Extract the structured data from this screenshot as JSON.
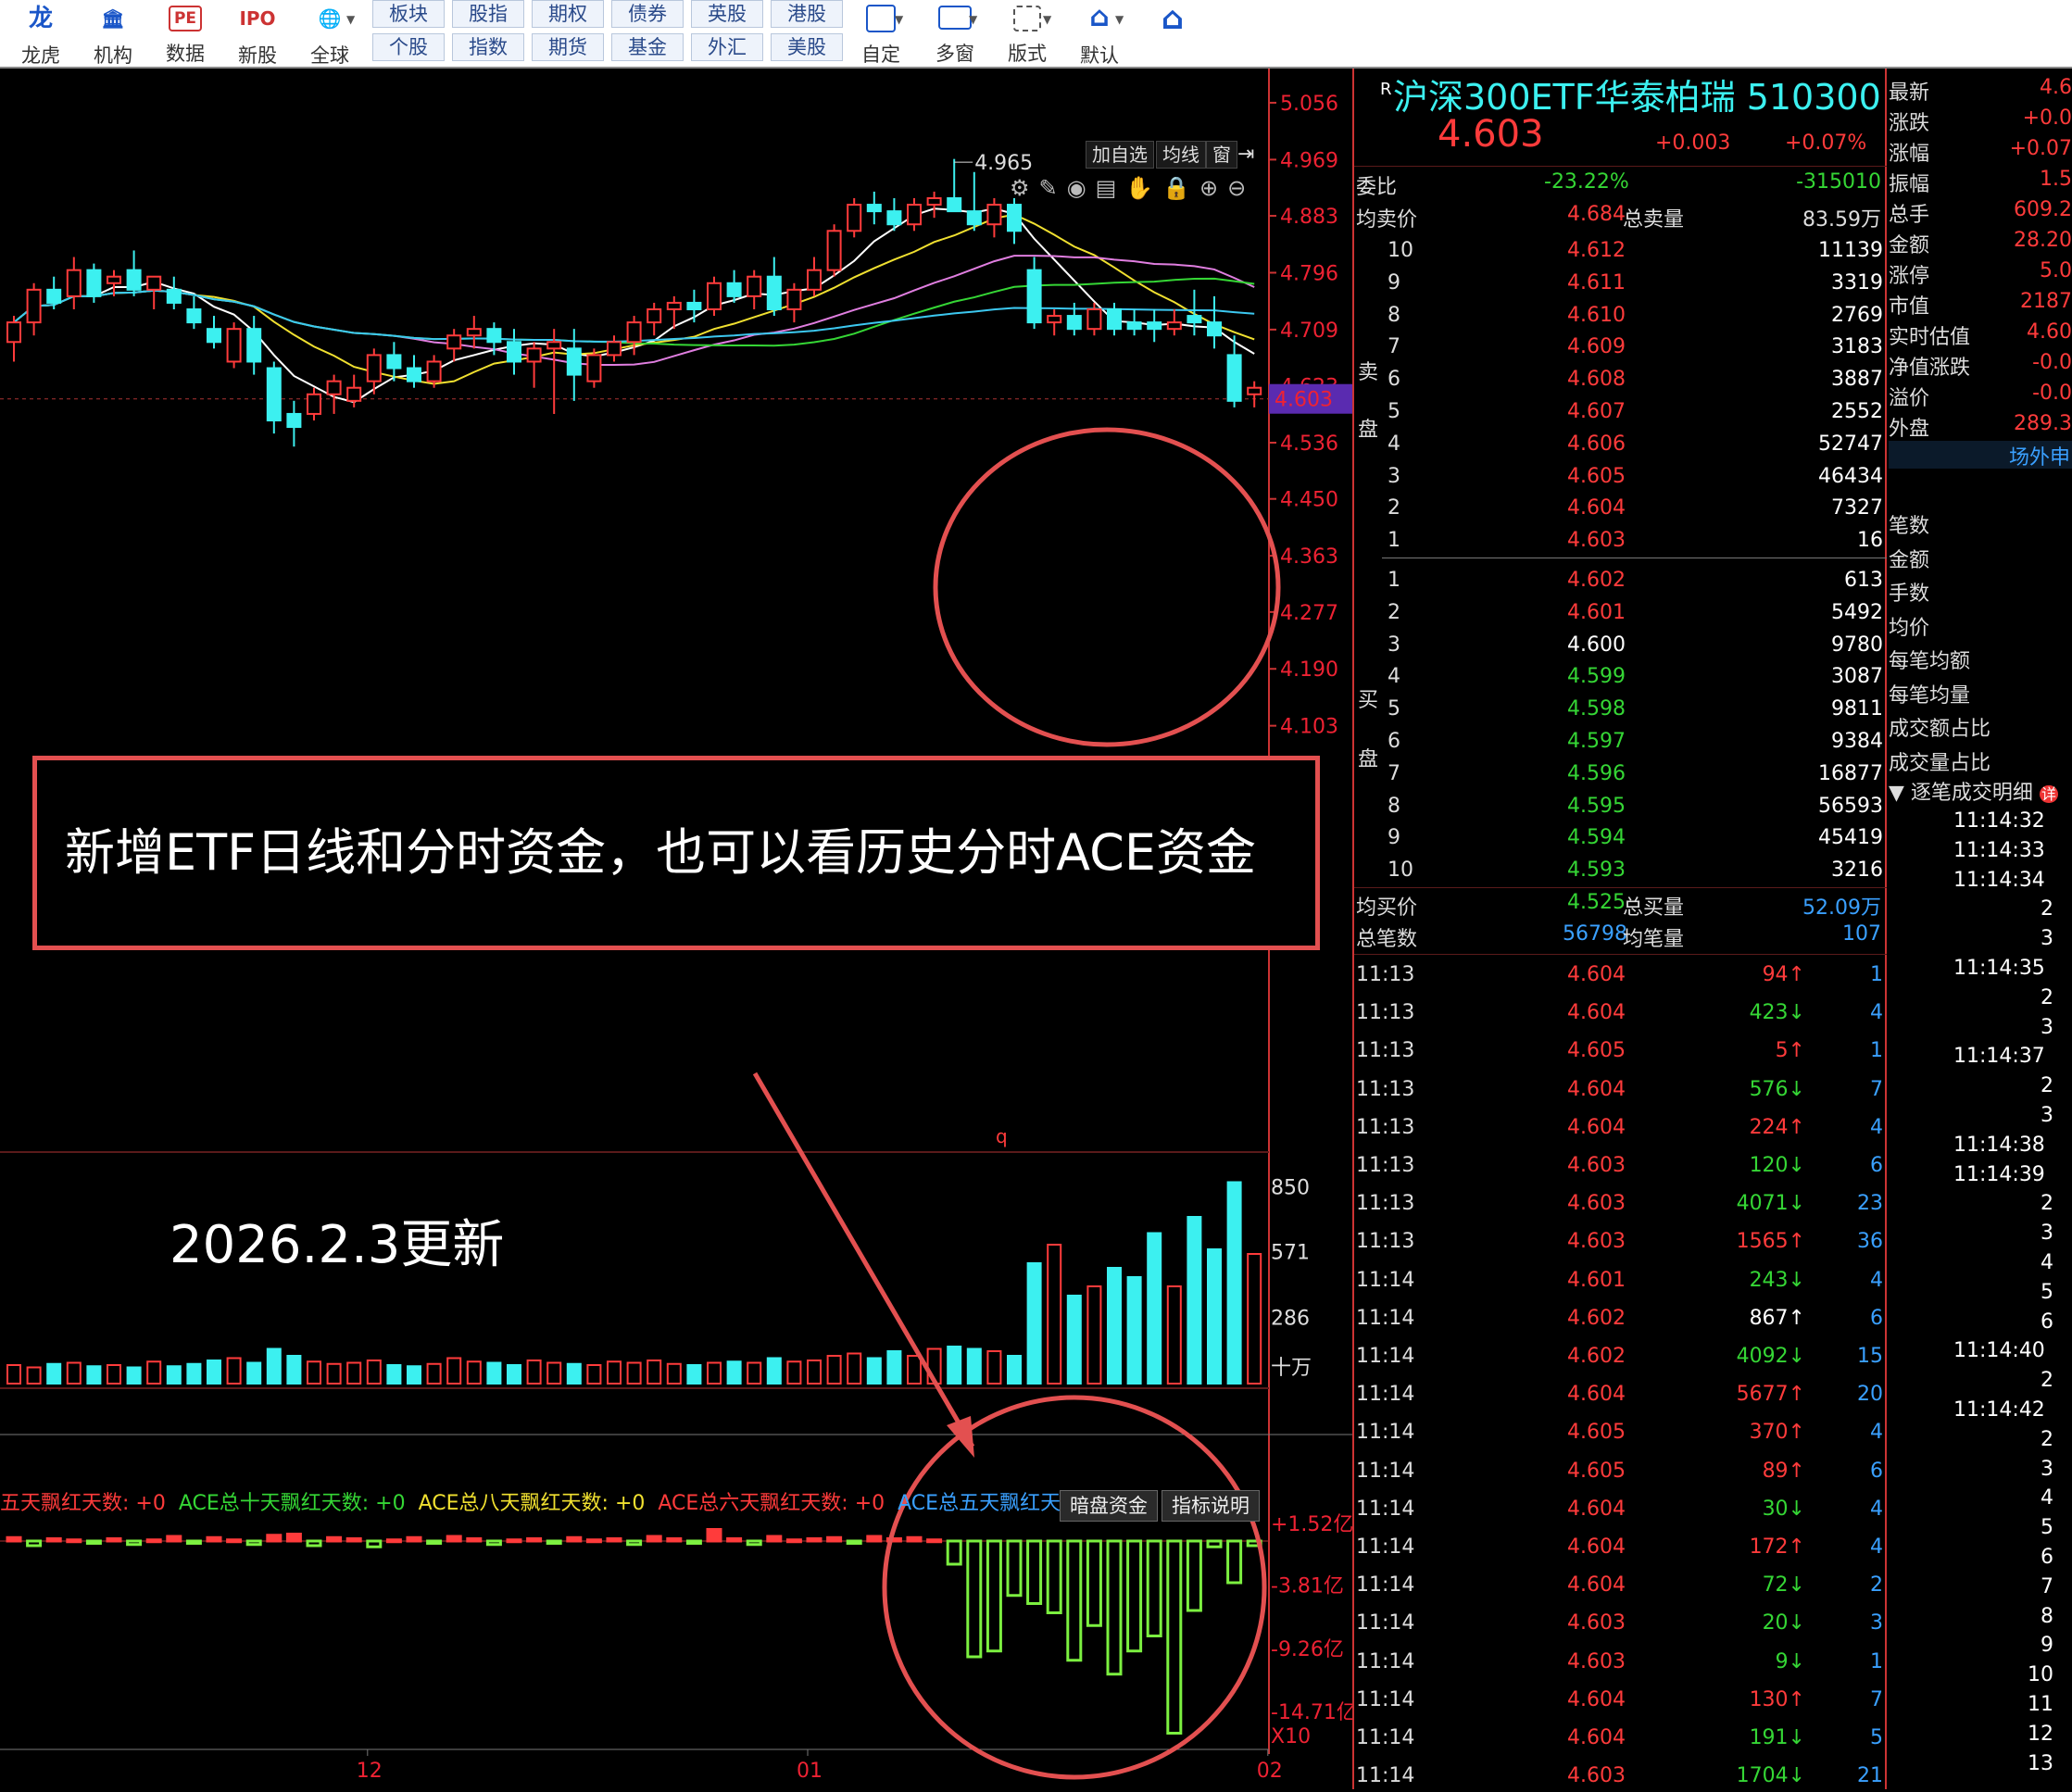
{
  "toolbar": {
    "buttons": [
      {
        "label": "龙虎",
        "icon": "龙"
      },
      {
        "label": "机构",
        "icon": "🏛"
      },
      {
        "label": "数据",
        "icon": "PE"
      },
      {
        "label": "新股",
        "icon": "IPO"
      },
      {
        "label": "全球",
        "icon": "🌐"
      }
    ],
    "markets_top": [
      "板块",
      "股指",
      "期权",
      "债券",
      "英股",
      "港股"
    ],
    "markets_bottom": [
      "个股",
      "指数",
      "期货",
      "基金",
      "外汇",
      "美股"
    ],
    "tools": [
      {
        "label": "自定"
      },
      {
        "label": "多窗"
      },
      {
        "label": "版式"
      },
      {
        "label": "默认"
      }
    ]
  },
  "chart": {
    "tabs": [
      "加自选",
      "均线",
      "窗"
    ],
    "price_axis": [
      "5.056",
      "4.969",
      "4.883",
      "4.796",
      "4.709",
      "4.623",
      "4.536",
      "4.450",
      "4.363",
      "4.277",
      "4.190",
      "4.103"
    ],
    "current_price": "4.603",
    "high_label": "4.965",
    "banner_text": "新增ETF日线和分时资金，也可以看历史分时ACE资金",
    "update_text": "2026.2.3更新",
    "vol_marker": "q",
    "volume_axis": [
      "850",
      "571",
      "286"
    ],
    "volume_unit": "十万",
    "ace_legend": [
      {
        "text": "五天飘红天数: +0",
        "color": "#ff3b3b"
      },
      {
        "text": "ACE总十天飘红天数: +0",
        "color": "#35d635"
      },
      {
        "text": "ACE总八天飘红天数: +0",
        "color": "#f0e030"
      },
      {
        "text": "ACE总六天飘红天数: +0",
        "color": "#ff3b3b"
      },
      {
        "text": "ACE总五天飘红天数: +0",
        "color": "#3aa0ff"
      }
    ],
    "ace_buttons": [
      "暗盘资金",
      "指标说明"
    ],
    "ace_axis": [
      "+1.52亿",
      "-3.81亿",
      "-9.26亿",
      "-14.71亿"
    ],
    "ace_unit": "X10",
    "date_axis": [
      "12",
      "01",
      "02"
    ]
  },
  "chart_data": {
    "type": "candlestick",
    "ylim": [
      4.06,
      5.08
    ],
    "candles": [
      [
        4.69,
        4.73,
        4.66,
        4.72
      ],
      [
        4.72,
        4.78,
        4.7,
        4.77
      ],
      [
        4.77,
        4.79,
        4.74,
        4.75
      ],
      [
        4.76,
        4.82,
        4.74,
        4.8
      ],
      [
        4.8,
        4.81,
        4.75,
        4.76
      ],
      [
        4.78,
        4.8,
        4.76,
        4.79
      ],
      [
        4.8,
        4.83,
        4.76,
        4.77
      ],
      [
        4.77,
        4.79,
        4.74,
        4.79
      ],
      [
        4.77,
        4.79,
        4.74,
        4.75
      ],
      [
        4.74,
        4.76,
        4.71,
        4.72
      ],
      [
        4.71,
        4.73,
        4.68,
        4.69
      ],
      [
        4.66,
        4.72,
        4.65,
        4.71
      ],
      [
        4.71,
        4.73,
        4.64,
        4.66
      ],
      [
        4.65,
        4.66,
        4.55,
        4.57
      ],
      [
        4.58,
        4.6,
        4.53,
        4.56
      ],
      [
        4.58,
        4.62,
        4.57,
        4.61
      ],
      [
        4.61,
        4.64,
        4.58,
        4.63
      ],
      [
        4.6,
        4.64,
        4.59,
        4.62
      ],
      [
        4.63,
        4.68,
        4.61,
        4.67
      ],
      [
        4.67,
        4.69,
        4.63,
        4.65
      ],
      [
        4.65,
        4.67,
        4.62,
        4.63
      ],
      [
        4.63,
        4.67,
        4.62,
        4.66
      ],
      [
        4.68,
        4.71,
        4.66,
        4.7
      ],
      [
        4.7,
        4.73,
        4.68,
        4.71
      ],
      [
        4.71,
        4.72,
        4.67,
        4.69
      ],
      [
        4.69,
        4.71,
        4.64,
        4.66
      ],
      [
        4.66,
        4.69,
        4.62,
        4.68
      ],
      [
        4.68,
        4.71,
        4.58,
        4.69
      ],
      [
        4.68,
        4.71,
        4.6,
        4.64
      ],
      [
        4.63,
        4.68,
        4.62,
        4.67
      ],
      [
        4.67,
        4.7,
        4.66,
        4.69
      ],
      [
        4.69,
        4.73,
        4.67,
        4.72
      ],
      [
        4.72,
        4.75,
        4.7,
        4.74
      ],
      [
        4.74,
        4.76,
        4.71,
        4.75
      ],
      [
        4.75,
        4.77,
        4.72,
        4.74
      ],
      [
        4.74,
        4.79,
        4.73,
        4.78
      ],
      [
        4.78,
        4.8,
        4.75,
        4.76
      ],
      [
        4.76,
        4.8,
        4.74,
        4.79
      ],
      [
        4.79,
        4.82,
        4.73,
        4.74
      ],
      [
        4.74,
        4.78,
        4.72,
        4.77
      ],
      [
        4.77,
        4.82,
        4.76,
        4.8
      ],
      [
        4.8,
        4.87,
        4.79,
        4.86
      ],
      [
        4.86,
        4.91,
        4.85,
        4.9
      ],
      [
        4.9,
        4.92,
        4.87,
        4.89
      ],
      [
        4.89,
        4.91,
        4.86,
        4.87
      ],
      [
        4.87,
        4.91,
        4.86,
        4.9
      ],
      [
        4.9,
        4.92,
        4.88,
        4.91
      ],
      [
        4.91,
        4.97,
        4.89,
        4.89
      ],
      [
        4.89,
        4.95,
        4.86,
        4.87
      ],
      [
        4.87,
        4.91,
        4.85,
        4.9
      ],
      [
        4.9,
        4.91,
        4.84,
        4.86
      ],
      [
        4.8,
        4.82,
        4.71,
        4.72
      ],
      [
        4.72,
        4.74,
        4.7,
        4.73
      ],
      [
        4.73,
        4.75,
        4.7,
        4.71
      ],
      [
        4.71,
        4.75,
        4.7,
        4.74
      ],
      [
        4.74,
        4.75,
        4.7,
        4.71
      ],
      [
        4.72,
        4.74,
        4.7,
        4.71
      ],
      [
        4.72,
        4.74,
        4.69,
        4.71
      ],
      [
        4.71,
        4.74,
        4.7,
        4.72
      ],
      [
        4.73,
        4.77,
        4.7,
        4.72
      ],
      [
        4.72,
        4.76,
        4.68,
        4.7
      ],
      [
        4.67,
        4.7,
        4.59,
        4.6
      ],
      [
        4.61,
        4.63,
        4.59,
        4.62
      ]
    ],
    "volume_ticks": [
      850,
      571,
      286
    ],
    "ace_ticks": [
      "+1.52亿",
      "-3.81亿",
      "-9.26亿",
      "-14.71亿"
    ]
  },
  "quote": {
    "badge": "R",
    "title": "沪深300ETF华泰柏瑞 510300",
    "price": "4.603",
    "change": "+0.003",
    "change_pct": "+0.07%",
    "weibi_label": "委比",
    "weibi_pct": "-23.22%",
    "weibi_val": "-315010",
    "avg_sell_label": "均卖价",
    "avg_sell": "4.684",
    "total_sell_label": "总卖量",
    "total_sell": "83.59万",
    "sell_side_label": "卖",
    "sell_side_label2": "盘",
    "buy_side_label": "买",
    "buy_side_label2": "盘",
    "asks": [
      {
        "n": "10",
        "p": "4.612",
        "v": "11139"
      },
      {
        "n": "9",
        "p": "4.611",
        "v": "3319"
      },
      {
        "n": "8",
        "p": "4.610",
        "v": "2769"
      },
      {
        "n": "7",
        "p": "4.609",
        "v": "3183"
      },
      {
        "n": "6",
        "p": "4.608",
        "v": "3887"
      },
      {
        "n": "5",
        "p": "4.607",
        "v": "2552"
      },
      {
        "n": "4",
        "p": "4.606",
        "v": "52747"
      },
      {
        "n": "3",
        "p": "4.605",
        "v": "46434"
      },
      {
        "n": "2",
        "p": "4.604",
        "v": "7327"
      },
      {
        "n": "1",
        "p": "4.603",
        "v": "16"
      }
    ],
    "bids": [
      {
        "n": "1",
        "p": "4.602",
        "v": "613",
        "c": "#ff3b3b"
      },
      {
        "n": "2",
        "p": "4.601",
        "v": "5492",
        "c": "#ff3b3b"
      },
      {
        "n": "3",
        "p": "4.600",
        "v": "9780",
        "c": "#ffffff"
      },
      {
        "n": "4",
        "p": "4.599",
        "v": "3087",
        "c": "#35d635"
      },
      {
        "n": "5",
        "p": "4.598",
        "v": "9811",
        "c": "#35d635"
      },
      {
        "n": "6",
        "p": "4.597",
        "v": "9384",
        "c": "#35d635"
      },
      {
        "n": "7",
        "p": "4.596",
        "v": "16877",
        "c": "#35d635"
      },
      {
        "n": "8",
        "p": "4.595",
        "v": "56593",
        "c": "#35d635"
      },
      {
        "n": "9",
        "p": "4.594",
        "v": "45419",
        "c": "#35d635"
      },
      {
        "n": "10",
        "p": "4.593",
        "v": "3216",
        "c": "#35d635"
      }
    ],
    "avg_buy_label": "均买价",
    "avg_buy": "4.525",
    "total_buy_label": "总买量",
    "total_buy": "52.09万",
    "total_trades_label": "总笔数",
    "total_trades": "56798",
    "avg_per_trade_label": "均笔量",
    "avg_per_trade": "107",
    "ticks": [
      {
        "t": "11:13",
        "p": "4.604",
        "v": "94",
        "d": "↑",
        "n": "1"
      },
      {
        "t": "11:13",
        "p": "4.604",
        "v": "423",
        "d": "↓",
        "n": "4"
      },
      {
        "t": "11:13",
        "p": "4.605",
        "v": "5",
        "d": "↑",
        "n": "1"
      },
      {
        "t": "11:13",
        "p": "4.604",
        "v": "576",
        "d": "↓",
        "n": "7"
      },
      {
        "t": "11:13",
        "p": "4.604",
        "v": "224",
        "d": "↑",
        "n": "4"
      },
      {
        "t": "11:13",
        "p": "4.603",
        "v": "120",
        "d": "↓",
        "n": "6"
      },
      {
        "t": "11:13",
        "p": "4.603",
        "v": "4071",
        "d": "↓",
        "n": "23"
      },
      {
        "t": "11:13",
        "p": "4.603",
        "v": "1565",
        "d": "↑",
        "n": "36"
      },
      {
        "t": "11:14",
        "p": "4.601",
        "v": "243",
        "d": "↓",
        "n": "4"
      },
      {
        "t": "11:14",
        "p": "4.602",
        "v": "867",
        "d": "↑",
        "n": "6"
      },
      {
        "t": "11:14",
        "p": "4.602",
        "v": "4092",
        "d": "↓",
        "n": "15"
      },
      {
        "t": "11:14",
        "p": "4.604",
        "v": "5677",
        "d": "↑",
        "n": "20"
      },
      {
        "t": "11:14",
        "p": "4.605",
        "v": "370",
        "d": "↑",
        "n": "4"
      },
      {
        "t": "11:14",
        "p": "4.605",
        "v": "89",
        "d": "↑",
        "n": "6"
      },
      {
        "t": "11:14",
        "p": "4.604",
        "v": "30",
        "d": "↓",
        "n": "4"
      },
      {
        "t": "11:14",
        "p": "4.604",
        "v": "172",
        "d": "↑",
        "n": "4"
      },
      {
        "t": "11:14",
        "p": "4.604",
        "v": "72",
        "d": "↓",
        "n": "2"
      },
      {
        "t": "11:14",
        "p": "4.603",
        "v": "20",
        "d": "↓",
        "n": "3"
      },
      {
        "t": "11:14",
        "p": "4.603",
        "v": "9",
        "d": "↓",
        "n": "1"
      },
      {
        "t": "11:14",
        "p": "4.604",
        "v": "130",
        "d": "↑",
        "n": "7"
      },
      {
        "t": "11:14",
        "p": "4.604",
        "v": "191",
        "d": "↓",
        "n": "5"
      },
      {
        "t": "11:14",
        "p": "4.603",
        "v": "1704",
        "d": "↓",
        "n": "21"
      }
    ],
    "stats": [
      {
        "k": "最新",
        "v": "4.6"
      },
      {
        "k": "涨跌",
        "v": "+0.0"
      },
      {
        "k": "涨幅",
        "v": "+0.07"
      },
      {
        "k": "振幅",
        "v": "1.5"
      },
      {
        "k": "总手",
        "v": "609.2"
      },
      {
        "k": "金额",
        "v": "28.20"
      },
      {
        "k": "涨停",
        "v": "5.0"
      },
      {
        "k": "市值",
        "v": "2187"
      },
      {
        "k": "实时估值",
        "v": "4.60"
      },
      {
        "k": "净值涨跌",
        "v": "-0.0"
      },
      {
        "k": "溢价",
        "v": "-0.0"
      },
      {
        "k": "外盘",
        "v": "289.3"
      }
    ],
    "offsite_tab": "场外申",
    "stats2": [
      "笔数",
      "金额",
      "手数",
      "均价",
      "每笔均额",
      "每笔均量",
      "成交额占比",
      "成交量占比"
    ],
    "detail_title": "逐笔成交明细",
    "detail_badge": "详",
    "detail_rows": [
      "11:14:32",
      "11:14:33",
      "11:14:34",
      "2",
      "3",
      "11:14:35",
      "2",
      "3",
      "11:14:37",
      "2",
      "3",
      "11:14:38",
      "11:14:39",
      "2",
      "3",
      "4",
      "5",
      "6",
      "11:14:40",
      "2",
      "11:14:42",
      "2",
      "3",
      "4",
      "5",
      "6",
      "7",
      "8",
      "9",
      "10",
      "11",
      "12",
      "13"
    ]
  }
}
